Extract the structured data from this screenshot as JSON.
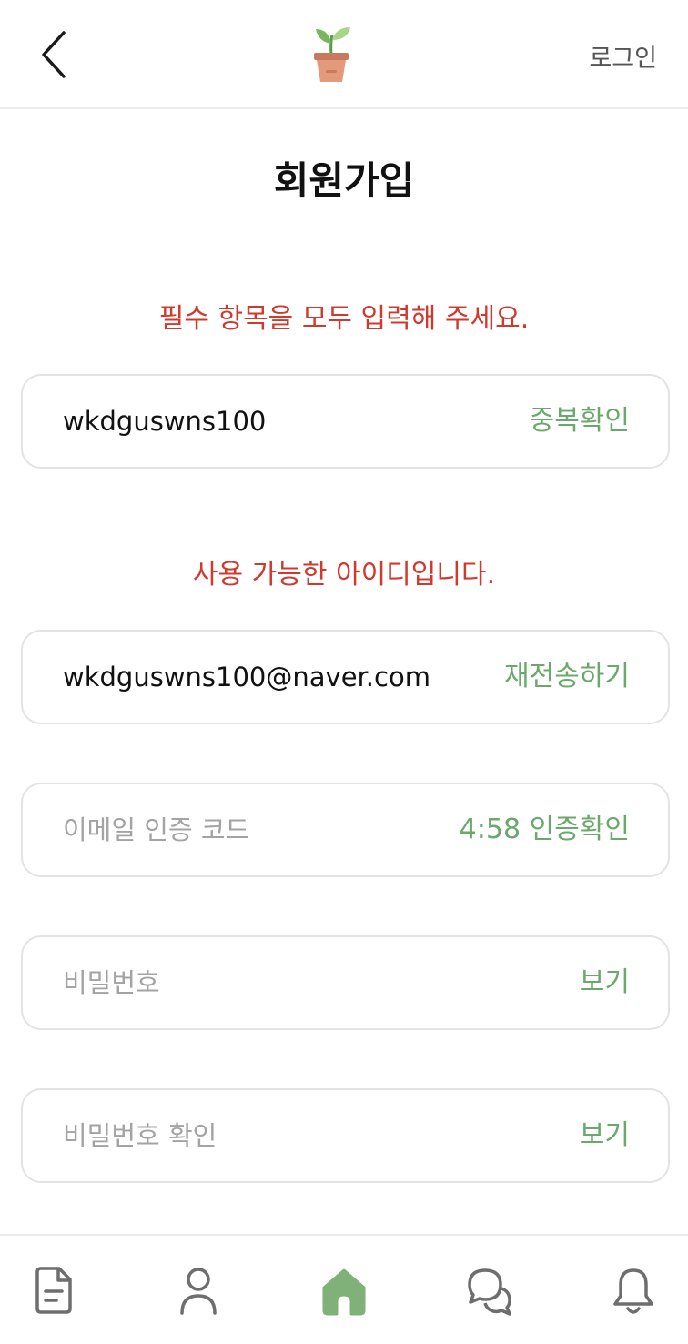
{
  "header": {
    "back_icon": "chevron-left-icon",
    "logo_icon": "sprout-pot-icon",
    "login_label": "로그인"
  },
  "page_title": "회원가입",
  "messages": {
    "required": "필수 항목을 모두 입력해 주세요.",
    "id_available": "사용 가능한 아이디입니다."
  },
  "form": {
    "user_id": {
      "value": "wkdguswns100",
      "placeholder": "",
      "action_label": "중복확인"
    },
    "email": {
      "value": "wkdguswns100@naver.com",
      "placeholder": "",
      "action_label": "재전송하기"
    },
    "email_code": {
      "value": "",
      "placeholder": "이메일 인증 코드",
      "timer": "4:58",
      "action_label": "인증확인"
    },
    "password": {
      "value": "",
      "placeholder": "비밀번호",
      "action_label": "보기"
    },
    "password_confirm": {
      "value": "",
      "placeholder": "비밀번호 확인",
      "action_label": "보기"
    }
  },
  "bottom_nav": {
    "items": [
      {
        "icon": "document-icon",
        "active": false
      },
      {
        "icon": "person-icon",
        "active": false
      },
      {
        "icon": "home-icon",
        "active": true
      },
      {
        "icon": "chat-bubbles-icon",
        "active": false
      },
      {
        "icon": "bell-icon",
        "active": false
      }
    ]
  },
  "colors": {
    "accent_green": "#6aa86b",
    "error_red": "#d03a2e",
    "placeholder_gray": "#a3a3a3",
    "icon_gray": "#6e6e6e"
  }
}
